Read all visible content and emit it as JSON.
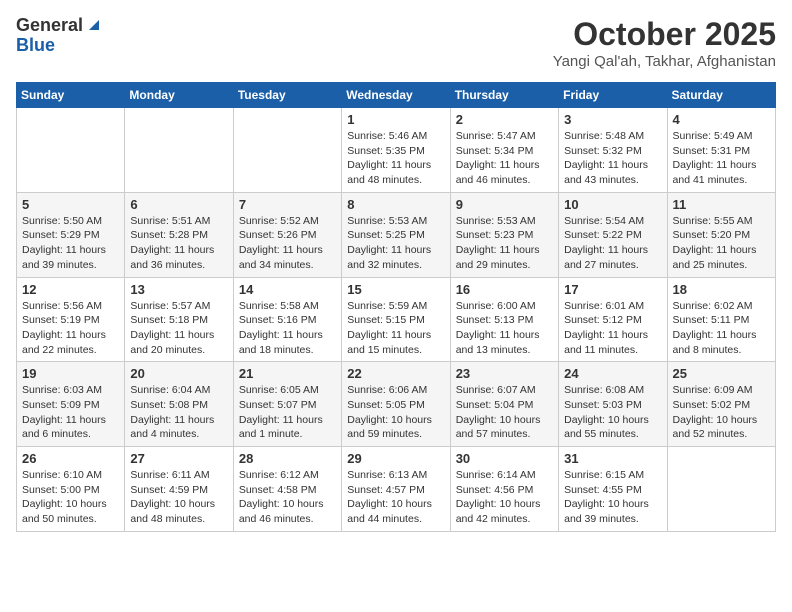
{
  "logo": {
    "general": "General",
    "blue": "Blue"
  },
  "title": "October 2025",
  "location": "Yangi Qal'ah, Takhar, Afghanistan",
  "days_header": [
    "Sunday",
    "Monday",
    "Tuesday",
    "Wednesday",
    "Thursday",
    "Friday",
    "Saturday"
  ],
  "weeks": [
    [
      {
        "day": "",
        "info": ""
      },
      {
        "day": "",
        "info": ""
      },
      {
        "day": "",
        "info": ""
      },
      {
        "day": "1",
        "info": "Sunrise: 5:46 AM\nSunset: 5:35 PM\nDaylight: 11 hours\nand 48 minutes."
      },
      {
        "day": "2",
        "info": "Sunrise: 5:47 AM\nSunset: 5:34 PM\nDaylight: 11 hours\nand 46 minutes."
      },
      {
        "day": "3",
        "info": "Sunrise: 5:48 AM\nSunset: 5:32 PM\nDaylight: 11 hours\nand 43 minutes."
      },
      {
        "day": "4",
        "info": "Sunrise: 5:49 AM\nSunset: 5:31 PM\nDaylight: 11 hours\nand 41 minutes."
      }
    ],
    [
      {
        "day": "5",
        "info": "Sunrise: 5:50 AM\nSunset: 5:29 PM\nDaylight: 11 hours\nand 39 minutes."
      },
      {
        "day": "6",
        "info": "Sunrise: 5:51 AM\nSunset: 5:28 PM\nDaylight: 11 hours\nand 36 minutes."
      },
      {
        "day": "7",
        "info": "Sunrise: 5:52 AM\nSunset: 5:26 PM\nDaylight: 11 hours\nand 34 minutes."
      },
      {
        "day": "8",
        "info": "Sunrise: 5:53 AM\nSunset: 5:25 PM\nDaylight: 11 hours\nand 32 minutes."
      },
      {
        "day": "9",
        "info": "Sunrise: 5:53 AM\nSunset: 5:23 PM\nDaylight: 11 hours\nand 29 minutes."
      },
      {
        "day": "10",
        "info": "Sunrise: 5:54 AM\nSunset: 5:22 PM\nDaylight: 11 hours\nand 27 minutes."
      },
      {
        "day": "11",
        "info": "Sunrise: 5:55 AM\nSunset: 5:20 PM\nDaylight: 11 hours\nand 25 minutes."
      }
    ],
    [
      {
        "day": "12",
        "info": "Sunrise: 5:56 AM\nSunset: 5:19 PM\nDaylight: 11 hours\nand 22 minutes."
      },
      {
        "day": "13",
        "info": "Sunrise: 5:57 AM\nSunset: 5:18 PM\nDaylight: 11 hours\nand 20 minutes."
      },
      {
        "day": "14",
        "info": "Sunrise: 5:58 AM\nSunset: 5:16 PM\nDaylight: 11 hours\nand 18 minutes."
      },
      {
        "day": "15",
        "info": "Sunrise: 5:59 AM\nSunset: 5:15 PM\nDaylight: 11 hours\nand 15 minutes."
      },
      {
        "day": "16",
        "info": "Sunrise: 6:00 AM\nSunset: 5:13 PM\nDaylight: 11 hours\nand 13 minutes."
      },
      {
        "day": "17",
        "info": "Sunrise: 6:01 AM\nSunset: 5:12 PM\nDaylight: 11 hours\nand 11 minutes."
      },
      {
        "day": "18",
        "info": "Sunrise: 6:02 AM\nSunset: 5:11 PM\nDaylight: 11 hours\nand 8 minutes."
      }
    ],
    [
      {
        "day": "19",
        "info": "Sunrise: 6:03 AM\nSunset: 5:09 PM\nDaylight: 11 hours\nand 6 minutes."
      },
      {
        "day": "20",
        "info": "Sunrise: 6:04 AM\nSunset: 5:08 PM\nDaylight: 11 hours\nand 4 minutes."
      },
      {
        "day": "21",
        "info": "Sunrise: 6:05 AM\nSunset: 5:07 PM\nDaylight: 11 hours\nand 1 minute."
      },
      {
        "day": "22",
        "info": "Sunrise: 6:06 AM\nSunset: 5:05 PM\nDaylight: 10 hours\nand 59 minutes."
      },
      {
        "day": "23",
        "info": "Sunrise: 6:07 AM\nSunset: 5:04 PM\nDaylight: 10 hours\nand 57 minutes."
      },
      {
        "day": "24",
        "info": "Sunrise: 6:08 AM\nSunset: 5:03 PM\nDaylight: 10 hours\nand 55 minutes."
      },
      {
        "day": "25",
        "info": "Sunrise: 6:09 AM\nSunset: 5:02 PM\nDaylight: 10 hours\nand 52 minutes."
      }
    ],
    [
      {
        "day": "26",
        "info": "Sunrise: 6:10 AM\nSunset: 5:00 PM\nDaylight: 10 hours\nand 50 minutes."
      },
      {
        "day": "27",
        "info": "Sunrise: 6:11 AM\nSunset: 4:59 PM\nDaylight: 10 hours\nand 48 minutes."
      },
      {
        "day": "28",
        "info": "Sunrise: 6:12 AM\nSunset: 4:58 PM\nDaylight: 10 hours\nand 46 minutes."
      },
      {
        "day": "29",
        "info": "Sunrise: 6:13 AM\nSunset: 4:57 PM\nDaylight: 10 hours\nand 44 minutes."
      },
      {
        "day": "30",
        "info": "Sunrise: 6:14 AM\nSunset: 4:56 PM\nDaylight: 10 hours\nand 42 minutes."
      },
      {
        "day": "31",
        "info": "Sunrise: 6:15 AM\nSunset: 4:55 PM\nDaylight: 10 hours\nand 39 minutes."
      },
      {
        "day": "",
        "info": ""
      }
    ]
  ]
}
